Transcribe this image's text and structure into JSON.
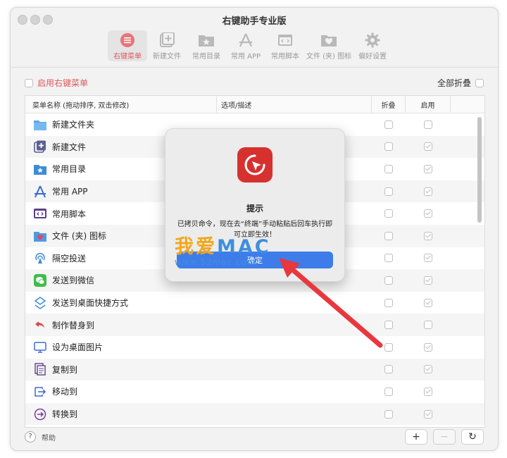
{
  "window": {
    "title": "右键助手专业版"
  },
  "toolbar": {
    "items": [
      {
        "label": "右键菜单",
        "icon": "list-icon",
        "active": true
      },
      {
        "label": "新建文件",
        "icon": "new-file-icon"
      },
      {
        "label": "常用目录",
        "icon": "folder-star-icon"
      },
      {
        "label": "常用 APP",
        "icon": "app-store-icon"
      },
      {
        "label": "常用脚本",
        "icon": "script-icon"
      },
      {
        "label": "文件 (夹) 图标",
        "icon": "folder-heart-icon"
      },
      {
        "label": "偏好设置",
        "icon": "gear-icon"
      }
    ]
  },
  "controls": {
    "enable_menu": "启用右键菜单",
    "collapse_all": "全部折叠"
  },
  "table": {
    "headers": [
      "菜单名称 (拖动排序, 双击修改)",
      "选项/描述",
      "折叠",
      "启用"
    ],
    "rows": [
      {
        "name": "新建文件夹",
        "icon": "folder-icon",
        "enabled": false
      },
      {
        "name": "新建文件",
        "icon": "new-file-icon",
        "enabled": true
      },
      {
        "name": "常用目录",
        "icon": "folder-star-icon",
        "enabled": true
      },
      {
        "name": "常用 APP",
        "icon": "app-store-icon",
        "enabled": true
      },
      {
        "name": "常用脚本",
        "icon": "script-icon",
        "enabled": true
      },
      {
        "name": "文件 (夹) 图标",
        "icon": "folder-heart-icon",
        "enabled": true
      },
      {
        "name": "隔空投送",
        "icon": "airdrop-icon",
        "enabled": true
      },
      {
        "name": "发送到微信",
        "icon": "wechat-icon",
        "enabled": true
      },
      {
        "name": "发送到桌面快捷方式",
        "icon": "shortcut-icon",
        "enabled": true
      },
      {
        "name": "制作替身到",
        "icon": "alias-icon",
        "enabled": false
      },
      {
        "name": "设为桌面图片",
        "icon": "desktop-icon",
        "enabled": true
      },
      {
        "name": "复制到",
        "icon": "copy-icon",
        "enabled": true
      },
      {
        "name": "移动到",
        "icon": "move-icon",
        "enabled": true
      },
      {
        "name": "转换到",
        "icon": "convert-icon",
        "enabled": true
      }
    ]
  },
  "footer": {
    "help": "帮助",
    "help_symbol": "?",
    "add": "+",
    "remove": "−",
    "refresh": "↻"
  },
  "dialog": {
    "title": "提示",
    "message": "已拷贝命令，现在去“终端”手动粘贴后回车执行即可立即生效！",
    "ok": "确定"
  },
  "watermark": {
    "text_a": "我爱",
    "text_b": "MAC",
    "url": "www.52mac.com"
  },
  "colors": {
    "accent": "#e0585d",
    "button": "#3e7de9",
    "icon_red": "#d7312f",
    "watermark_orange": "#f2a61b",
    "watermark_blue": "#3f8ede"
  }
}
